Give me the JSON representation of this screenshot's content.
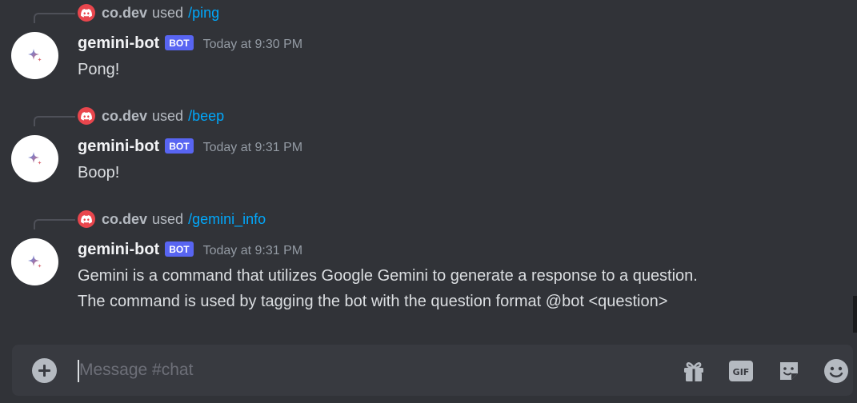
{
  "messages": [
    {
      "reply": {
        "user": "co.dev",
        "used": "used",
        "command": "/ping"
      },
      "author": "gemini-bot",
      "tag": "BOT",
      "timestamp": "Today at 9:30 PM",
      "lines": [
        "Pong!"
      ]
    },
    {
      "reply": {
        "user": "co.dev",
        "used": "used",
        "command": "/beep"
      },
      "author": "gemini-bot",
      "tag": "BOT",
      "timestamp": "Today at 9:31 PM",
      "lines": [
        "Boop!"
      ]
    },
    {
      "reply": {
        "user": "co.dev",
        "used": "used",
        "command": "/gemini_info"
      },
      "author": "gemini-bot",
      "tag": "BOT",
      "timestamp": "Today at 9:31 PM",
      "lines": [
        "Gemini is a command that utilizes Google Gemini to generate a response to a question.",
        "The command is used by tagging the bot with the question format @bot <question>"
      ]
    }
  ],
  "composer": {
    "placeholder": "Message #chat",
    "value": "",
    "icons": [
      "plus-circle-icon",
      "gift-icon",
      "gif-icon",
      "sticker-icon",
      "emoji-icon"
    ],
    "gif_label": "GIF"
  },
  "colors": {
    "background": "#313338",
    "composer": "#383a40",
    "bot_tag": "#5865f2",
    "command_link": "#00a8fc",
    "discord_badge": "#e9464d"
  }
}
